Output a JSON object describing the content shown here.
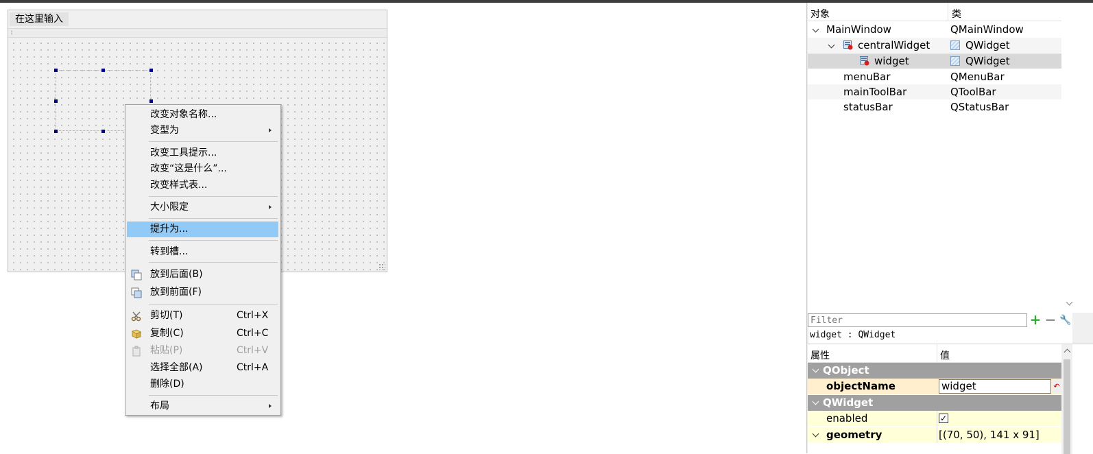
{
  "form": {
    "menu_placeholder": "在这里输入"
  },
  "context_menu": {
    "items": [
      {
        "label": "改变对象名称...",
        "submenu": false
      },
      {
        "label": "变型为",
        "submenu": true
      },
      {
        "label": "改变工具提示..."
      },
      {
        "label": "改变“这是什么”..."
      },
      {
        "label": "改变样式表..."
      },
      {
        "label": "大小限定",
        "submenu": true
      },
      {
        "label": "提升为...",
        "highlighted": true
      },
      {
        "label": "转到槽..."
      },
      {
        "label": "放到后面(B)",
        "icon": "send-to-back-icon"
      },
      {
        "label": "放到前面(F)",
        "icon": "bring-to-front-icon"
      },
      {
        "label": "剪切(T)",
        "shortcut": "Ctrl+X",
        "icon": "scissors-icon"
      },
      {
        "label": "复制(C)",
        "shortcut": "Ctrl+C",
        "icon": "copy-icon"
      },
      {
        "label": "粘贴(P)",
        "shortcut": "Ctrl+V",
        "icon": "paste-icon",
        "disabled": true
      },
      {
        "label": "选择全部(A)",
        "shortcut": "Ctrl+A"
      },
      {
        "label": "删除(D)"
      },
      {
        "label": "布局",
        "submenu": true
      }
    ]
  },
  "object_inspector": {
    "header_object": "对象",
    "header_class": "类",
    "rows": [
      {
        "name": "MainWindow",
        "class": "QMainWindow"
      },
      {
        "name": "centralWidget",
        "class": "QWidget"
      },
      {
        "name": "widget",
        "class": "QWidget"
      },
      {
        "name": "menuBar",
        "class": "QMenuBar"
      },
      {
        "name": "mainToolBar",
        "class": "QToolBar"
      },
      {
        "name": "statusBar",
        "class": "QStatusBar"
      }
    ]
  },
  "filter": {
    "placeholder": "Filter"
  },
  "object_caption": "widget : QWidget",
  "property_editor": {
    "header_property": "属性",
    "header_value": "值",
    "group_qobject": "QObject",
    "object_name_label": "objectName",
    "object_name_value": "widget",
    "group_qwidget": "QWidget",
    "enabled_label": "enabled",
    "enabled_checked": "✓",
    "geometry_label": "geometry",
    "geometry_value": "[(70, 50), 141 x 91]"
  },
  "colors": {
    "highlight": "#91c9f7",
    "group_header": "#a0a0a0",
    "selection_handle": "#000080"
  }
}
